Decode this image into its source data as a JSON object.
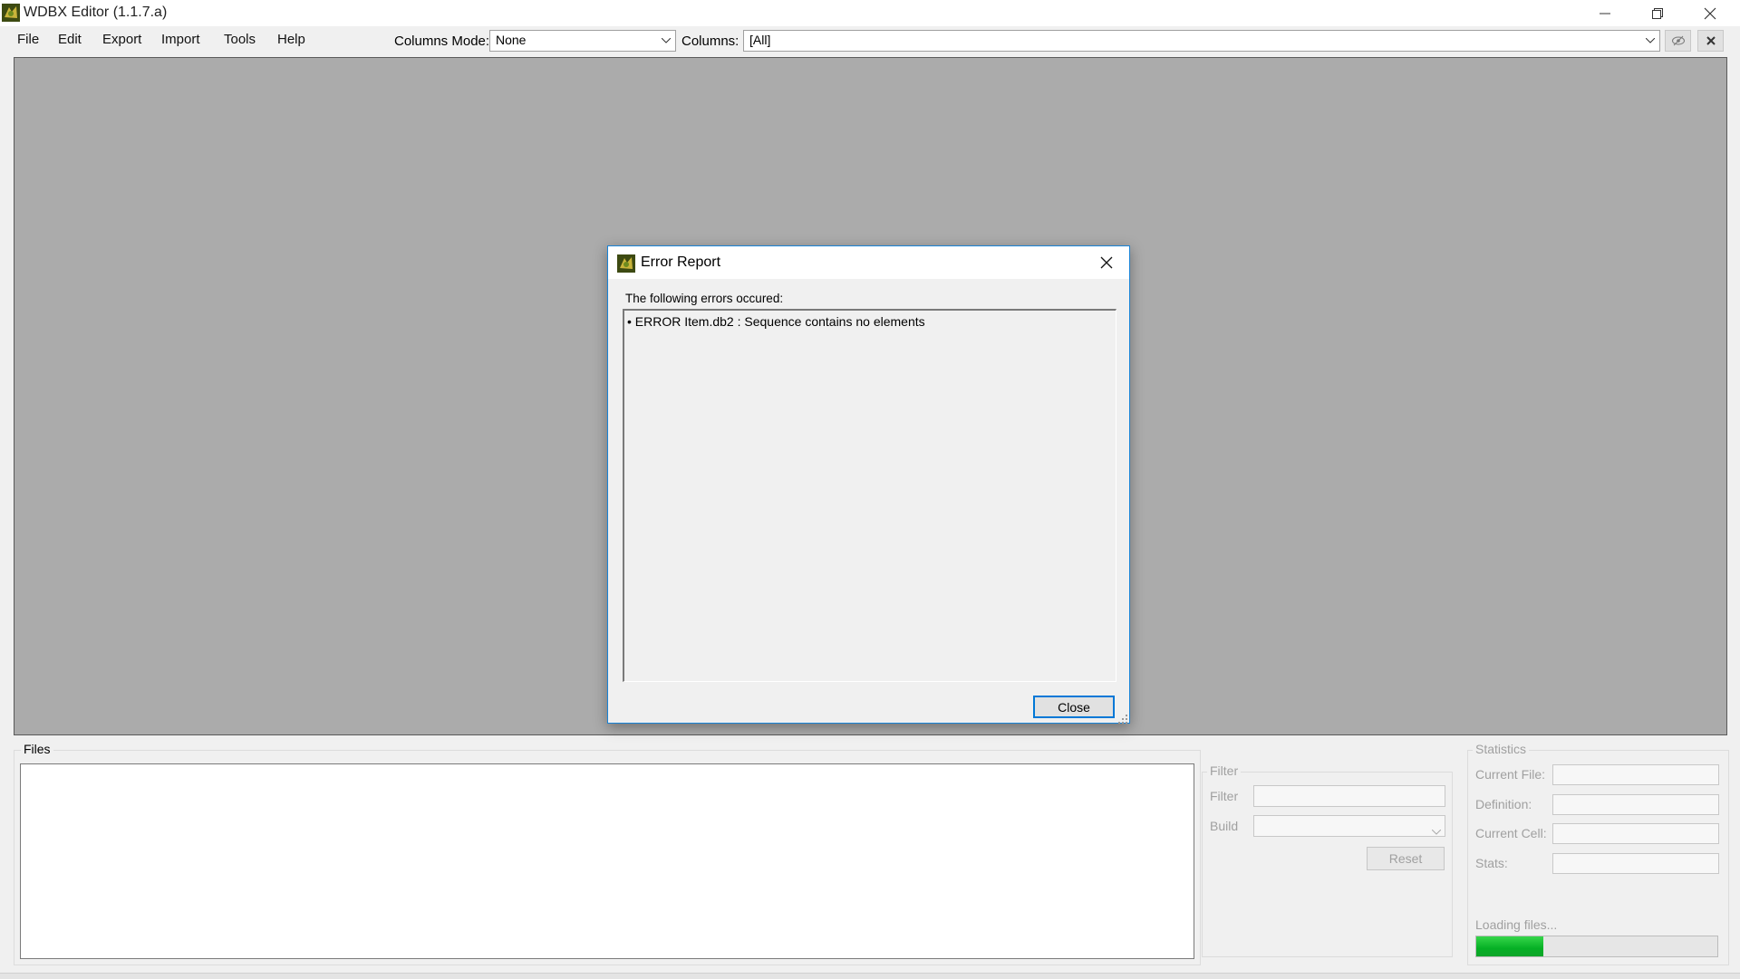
{
  "window": {
    "title": "WDBX Editor (1.1.7.a)"
  },
  "menu": {
    "items": [
      "File",
      "Edit",
      "Export",
      "Import",
      "Tools",
      "Help"
    ]
  },
  "toolbar": {
    "columns_mode_label": "Columns Mode:",
    "columns_mode_value": "None",
    "columns_label": "Columns:",
    "columns_value": "[All]"
  },
  "dialog": {
    "title": "Error Report",
    "message": "The following errors occured:",
    "errors": [
      "• ERROR Item.db2 : Sequence contains no elements"
    ],
    "close_label": "Close"
  },
  "files": {
    "title": "Files"
  },
  "filter": {
    "group_title": "Filter",
    "filter_label": "Filter",
    "build_label": "Build",
    "reset_label": "Reset"
  },
  "statistics": {
    "group_title": "Statistics",
    "current_file_label": "Current File:",
    "definition_label": "Definition:",
    "current_cell_label": "Current Cell:",
    "stats_label": "Stats:"
  },
  "loading": {
    "label": "Loading files...",
    "progress": 0.28
  },
  "colors": {
    "accent": "#0078d7",
    "progress": "#06b025",
    "grid_bg": "#ababab"
  }
}
